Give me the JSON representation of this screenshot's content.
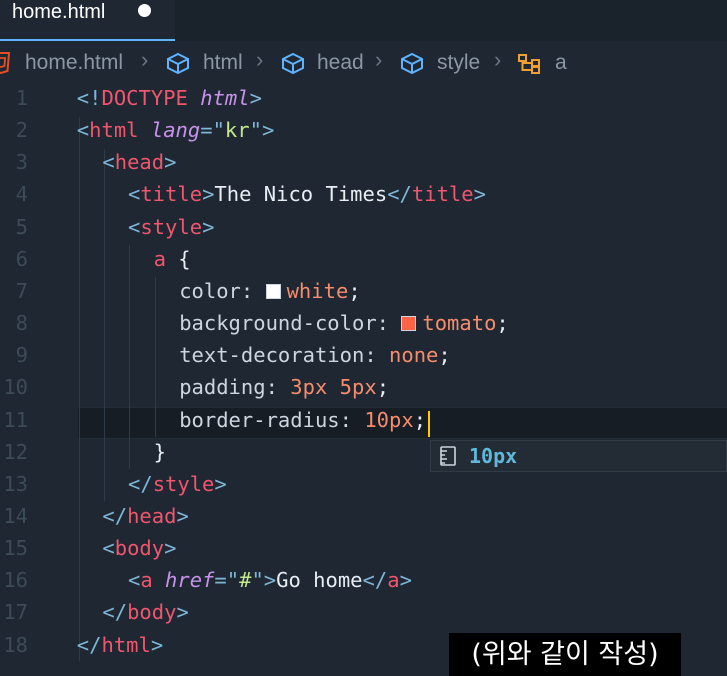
{
  "tab": {
    "label": "home.html",
    "unsaved_dot": true
  },
  "breadcrumb": {
    "file": "home.html",
    "items": [
      "html",
      "head",
      "style",
      "a"
    ]
  },
  "lines": [
    {
      "num": "1",
      "indent": 3,
      "tokens": [
        [
          "p",
          "<!"
        ],
        [
          "t",
          "DOCTYPE "
        ],
        [
          "a",
          "html"
        ],
        [
          "p",
          ">"
        ]
      ]
    },
    {
      "num": "2",
      "indent": 3,
      "tokens": [
        [
          "p",
          "<"
        ],
        [
          "t",
          "html "
        ],
        [
          "a",
          "lang"
        ],
        [
          "p",
          "=\""
        ],
        [
          "s",
          "kr"
        ],
        [
          "p",
          "\">"
        ]
      ]
    },
    {
      "num": "3",
      "indent": 4,
      "tokens": [
        [
          "p",
          "<"
        ],
        [
          "t",
          "head"
        ],
        [
          "p",
          ">"
        ]
      ]
    },
    {
      "num": "4",
      "indent": 5,
      "tokens": [
        [
          "p",
          "<"
        ],
        [
          "t",
          "title"
        ],
        [
          "p",
          ">"
        ],
        [
          "w",
          "The Nico Times"
        ],
        [
          "p",
          "</"
        ],
        [
          "t",
          "title"
        ],
        [
          "p",
          ">"
        ]
      ]
    },
    {
      "num": "5",
      "indent": 5,
      "tokens": [
        [
          "p",
          "<"
        ],
        [
          "t",
          "style"
        ],
        [
          "p",
          ">"
        ]
      ]
    },
    {
      "num": "6",
      "indent": 6,
      "tokens": [
        [
          "t",
          "a "
        ],
        [
          "w",
          "{"
        ]
      ]
    },
    {
      "num": "7",
      "indent": 7,
      "tokens": [
        [
          "prop",
          "color: "
        ],
        [
          "swatch",
          "#ffffff"
        ],
        [
          "v",
          "white"
        ],
        [
          "w",
          ";"
        ]
      ]
    },
    {
      "num": "8",
      "indent": 7,
      "tokens": [
        [
          "prop",
          "background-color: "
        ],
        [
          "swatch",
          "#ff6347"
        ],
        [
          "v",
          "tomato"
        ],
        [
          "w",
          ";"
        ]
      ]
    },
    {
      "num": "9",
      "indent": 7,
      "tokens": [
        [
          "prop",
          "text-decoration: "
        ],
        [
          "v",
          "none"
        ],
        [
          "w",
          ";"
        ]
      ]
    },
    {
      "num": "10",
      "indent": 7,
      "tokens": [
        [
          "prop",
          "padding: "
        ],
        [
          "v",
          "3px 5px"
        ],
        [
          "w",
          ";"
        ]
      ]
    },
    {
      "num": "11",
      "indent": 7,
      "tokens": [
        [
          "prop",
          "border-radius: "
        ],
        [
          "v",
          "10px"
        ],
        [
          "w",
          ";"
        ]
      ]
    },
    {
      "num": "12",
      "indent": 6,
      "tokens": [
        [
          "w",
          "}"
        ]
      ]
    },
    {
      "num": "13",
      "indent": 5,
      "tokens": [
        [
          "p",
          "</"
        ],
        [
          "t",
          "style"
        ],
        [
          "p",
          ">"
        ]
      ]
    },
    {
      "num": "14",
      "indent": 4,
      "tokens": [
        [
          "p",
          "</"
        ],
        [
          "t",
          "head"
        ],
        [
          "p",
          ">"
        ]
      ]
    },
    {
      "num": "15",
      "indent": 4,
      "tokens": [
        [
          "p",
          "<"
        ],
        [
          "t",
          "body"
        ],
        [
          "p",
          ">"
        ]
      ]
    },
    {
      "num": "16",
      "indent": 5,
      "tokens": [
        [
          "p",
          "<"
        ],
        [
          "t",
          "a "
        ],
        [
          "a",
          "href"
        ],
        [
          "p",
          "=\""
        ],
        [
          "s",
          "#"
        ],
        [
          "p",
          "\">"
        ],
        [
          "w",
          "Go home"
        ],
        [
          "p",
          "</"
        ],
        [
          "t",
          "a"
        ],
        [
          "p",
          ">"
        ]
      ]
    },
    {
      "num": "17",
      "indent": 4,
      "tokens": [
        [
          "p",
          "</"
        ],
        [
          "t",
          "body"
        ],
        [
          "p",
          ">"
        ]
      ]
    },
    {
      "num": "18",
      "indent": 3,
      "tokens": [
        [
          "p",
          "</"
        ],
        [
          "t",
          "html"
        ],
        [
          "p",
          ">"
        ]
      ]
    }
  ],
  "suggestion": {
    "label": "10px"
  },
  "caption": "(위와 같이 작성)",
  "colors": {
    "accent": "#5fb3ff",
    "caret": "#ffcc00",
    "tag": "#f0566e",
    "value": "#f78c6c"
  }
}
